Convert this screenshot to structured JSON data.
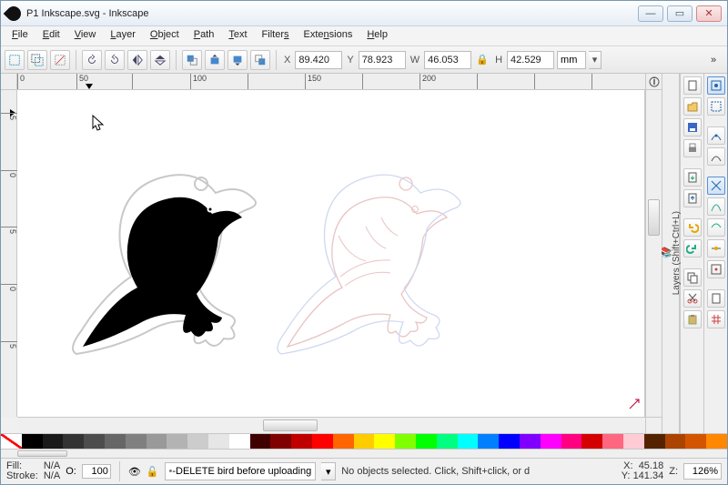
{
  "title": "P1 Inkscape.svg - Inkscape",
  "menu": [
    "File",
    "Edit",
    "View",
    "Layer",
    "Object",
    "Path",
    "Text",
    "Filters",
    "Extensions",
    "Help"
  ],
  "coords": {
    "X": "89.420",
    "Y": "78.923",
    "W": "46.053",
    "H": "42.529",
    "unit": "mm"
  },
  "ruler_h": [
    "0",
    "50",
    "",
    "100",
    "",
    "150",
    "",
    "200"
  ],
  "side_panel_label": "Layers (Shift+Ctrl+L)",
  "status": {
    "fill_label": "Fill:",
    "fill_value": "N/A",
    "stroke_label": "Stroke:",
    "stroke_value": "N/A",
    "opacity_label": "O:",
    "opacity_value": "100",
    "layer_name": "-DELETE bird before uploading",
    "message": "No objects selected. Click, Shift+click, or d",
    "cx_label": "X:",
    "cx": "45.18",
    "cy_label": "Y:",
    "cy": "141.34",
    "zlabel": "Z:",
    "zoom": "126%"
  },
  "palette_colors": [
    "none",
    "#000000",
    "#1a1a1a",
    "#333333",
    "#4d4d4d",
    "#666666",
    "#808080",
    "#999999",
    "#b3b3b3",
    "#cccccc",
    "#e6e6e6",
    "#ffffff",
    "#400000",
    "#800000",
    "#c00000",
    "#ff0000",
    "#ff6600",
    "#ffcc00",
    "#ffff00",
    "#80ff00",
    "#00ff00",
    "#00ff80",
    "#00ffff",
    "#0080ff",
    "#0000ff",
    "#8000ff",
    "#ff00ff",
    "#ff0080",
    "#d40000",
    "#ff6680",
    "#ffccd5",
    "#552200",
    "#aa4400",
    "#d45500",
    "#ff8800"
  ]
}
